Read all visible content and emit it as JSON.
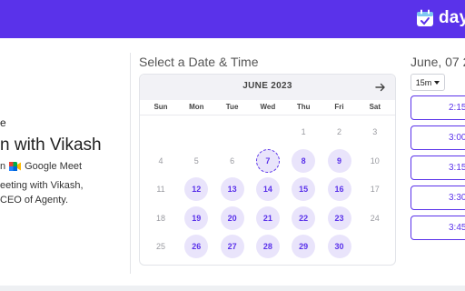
{
  "brand": {
    "name": "day"
  },
  "event": {
    "host_fragment": "e",
    "title": "n with Vikash",
    "duration_fragment": "n",
    "platform": "Google Meet",
    "description_line1": "eeting with Vikash,",
    "description_line2": "CEO of Agenty."
  },
  "calendar": {
    "section_title": "Select a Date & Time",
    "month_label": "JUNE 2023",
    "weekdays": [
      "Sun",
      "Mon",
      "Tue",
      "Wed",
      "Thu",
      "Fri",
      "Sat"
    ],
    "weeks": [
      [
        null,
        null,
        null,
        null,
        "1",
        "2",
        "3"
      ],
      [
        "4",
        "5",
        "6",
        "7",
        "8",
        "9",
        "10"
      ],
      [
        "11",
        "12",
        "13",
        "14",
        "15",
        "16",
        "17"
      ],
      [
        "18",
        "19",
        "20",
        "21",
        "22",
        "23",
        "24"
      ],
      [
        "25",
        "26",
        "27",
        "28",
        "29",
        "30",
        null
      ]
    ],
    "available": [
      "8",
      "9",
      "12",
      "13",
      "14",
      "15",
      "16",
      "19",
      "20",
      "21",
      "22",
      "23",
      "26",
      "27",
      "28",
      "29",
      "30"
    ],
    "selected": "7"
  },
  "times": {
    "date_heading": "June, 07 2",
    "duration_value": "15m",
    "slots": [
      "2:15",
      "3:00",
      "3:15",
      "3:30",
      "3:45"
    ]
  },
  "colors": {
    "accent": "#5a32ea",
    "available_bg": "#e9e4fb"
  }
}
